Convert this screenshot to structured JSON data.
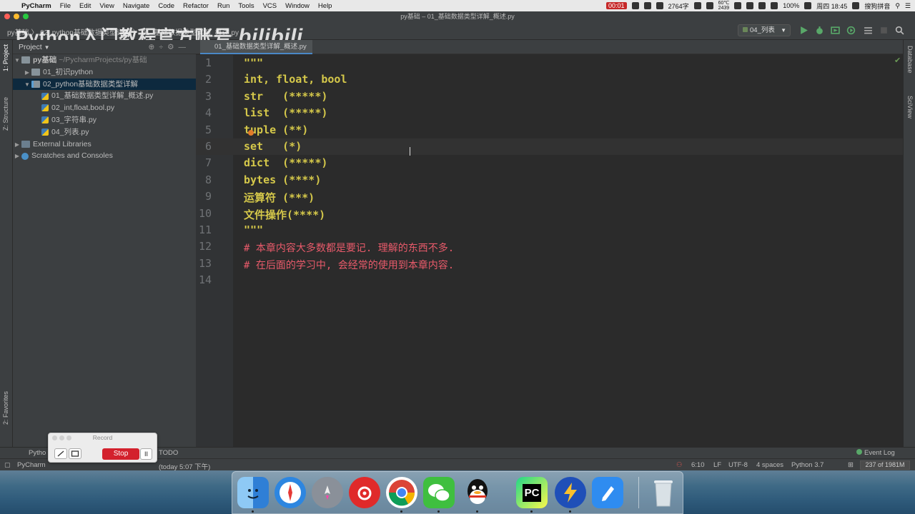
{
  "menubar": {
    "app_name": "PyCharm",
    "items": [
      "File",
      "Edit",
      "View",
      "Navigate",
      "Code",
      "Refactor",
      "Run",
      "Tools",
      "VCS",
      "Window",
      "Help"
    ],
    "status": {
      "record_time": "00:01",
      "net_speed": "2764字",
      "temp": "60℃",
      "fan": "2439",
      "battery": "100%",
      "clock": "周四 18:45",
      "input_method": "搜狗拼音"
    }
  },
  "window": {
    "title": "py基础 – 01_基础数据类型详解_概述.py"
  },
  "navbar": {
    "crumbs": "py基础 〉 02_python基础数据类型详解 〉 01_基础数据类型详解_概述.py",
    "run_config": "04_列表"
  },
  "watermark": {
    "channel": "Python入门教程官方账号",
    "logo": "bilibili"
  },
  "left_strip": {
    "project_tab": "1: Project",
    "structure_tab": "Z: Structure",
    "favorites_tab": "2: Favorites"
  },
  "right_strip": {
    "database_tab": "Database",
    "sciview_tab": "SciView"
  },
  "project": {
    "header": "Project",
    "root": {
      "name": "py基础",
      "path": "~/PycharmProjects/py基础"
    },
    "items": [
      {
        "label": "01_初识python",
        "type": "folder",
        "depth": 1,
        "arrow": "▶"
      },
      {
        "label": "02_python基础数据类型详解",
        "type": "folder",
        "depth": 1,
        "arrow": "▼",
        "selected": true
      },
      {
        "label": "01_基础数据类型详解_概述.py",
        "type": "py",
        "depth": 2,
        "arrow": ""
      },
      {
        "label": "02_int,float,bool.py",
        "type": "py",
        "depth": 2,
        "arrow": ""
      },
      {
        "label": "03_字符串.py",
        "type": "py",
        "depth": 2,
        "arrow": ""
      },
      {
        "label": "04_列表.py",
        "type": "py",
        "depth": 2,
        "arrow": ""
      },
      {
        "label": "External Libraries",
        "type": "lib",
        "depth": 0,
        "arrow": "▶"
      },
      {
        "label": "Scratches and Consoles",
        "type": "scratch",
        "depth": 0,
        "arrow": "▶"
      }
    ]
  },
  "editor": {
    "tab_label": "01_基础数据类型详解_概述.py",
    "lines": [
      {
        "no": "1",
        "text": "\"\"\"",
        "kind": "string"
      },
      {
        "no": "2",
        "text": "int, float, bool",
        "kind": "string"
      },
      {
        "no": "3",
        "text": "str   (*****)",
        "kind": "string"
      },
      {
        "no": "4",
        "text": "list  (*****)",
        "kind": "string"
      },
      {
        "no": "5",
        "text": "tuple (**)",
        "kind": "string"
      },
      {
        "no": "6",
        "text": "set   (*)",
        "kind": "string"
      },
      {
        "no": "7",
        "text": "dict  (*****)",
        "kind": "string"
      },
      {
        "no": "8",
        "text": "bytes (****)",
        "kind": "string"
      },
      {
        "no": "9",
        "text": "运算符 (***)",
        "kind": "string"
      },
      {
        "no": "10",
        "text": "文件操作(****)",
        "kind": "string"
      },
      {
        "no": "11",
        "text": "\"\"\"",
        "kind": "string"
      },
      {
        "no": "12",
        "text": "# 本章内容大多数都是要记. 理解的东西不多.",
        "kind": "comment"
      },
      {
        "no": "13",
        "text": "# 在后面的学习中, 会经常的使用到本章内容.",
        "kind": "comment"
      },
      {
        "no": "14",
        "text": "",
        "kind": "string"
      }
    ]
  },
  "bottom_bar": {
    "python_console": "Pytho",
    "todo": "TODO",
    "event_log": "Event Log"
  },
  "statusbar": {
    "left": "PyCharm",
    "left_tail": "(today 5:07 下午)",
    "position": "6:10",
    "line_sep": "LF",
    "encoding": "UTF-8",
    "indent": "4 spaces",
    "interpreter": "Python 3.7",
    "memory": "237 of 1981M"
  },
  "record_widget": {
    "title": "Record",
    "stop_label": "Stop",
    "pause_label": "II"
  },
  "dock": {
    "apps": [
      "finder",
      "safari",
      "launchpad",
      "netease-music",
      "chrome",
      "wechat",
      "qq",
      "pycharm",
      "bolt",
      "notes-app",
      "trash"
    ],
    "pycharm_label": "PC"
  }
}
